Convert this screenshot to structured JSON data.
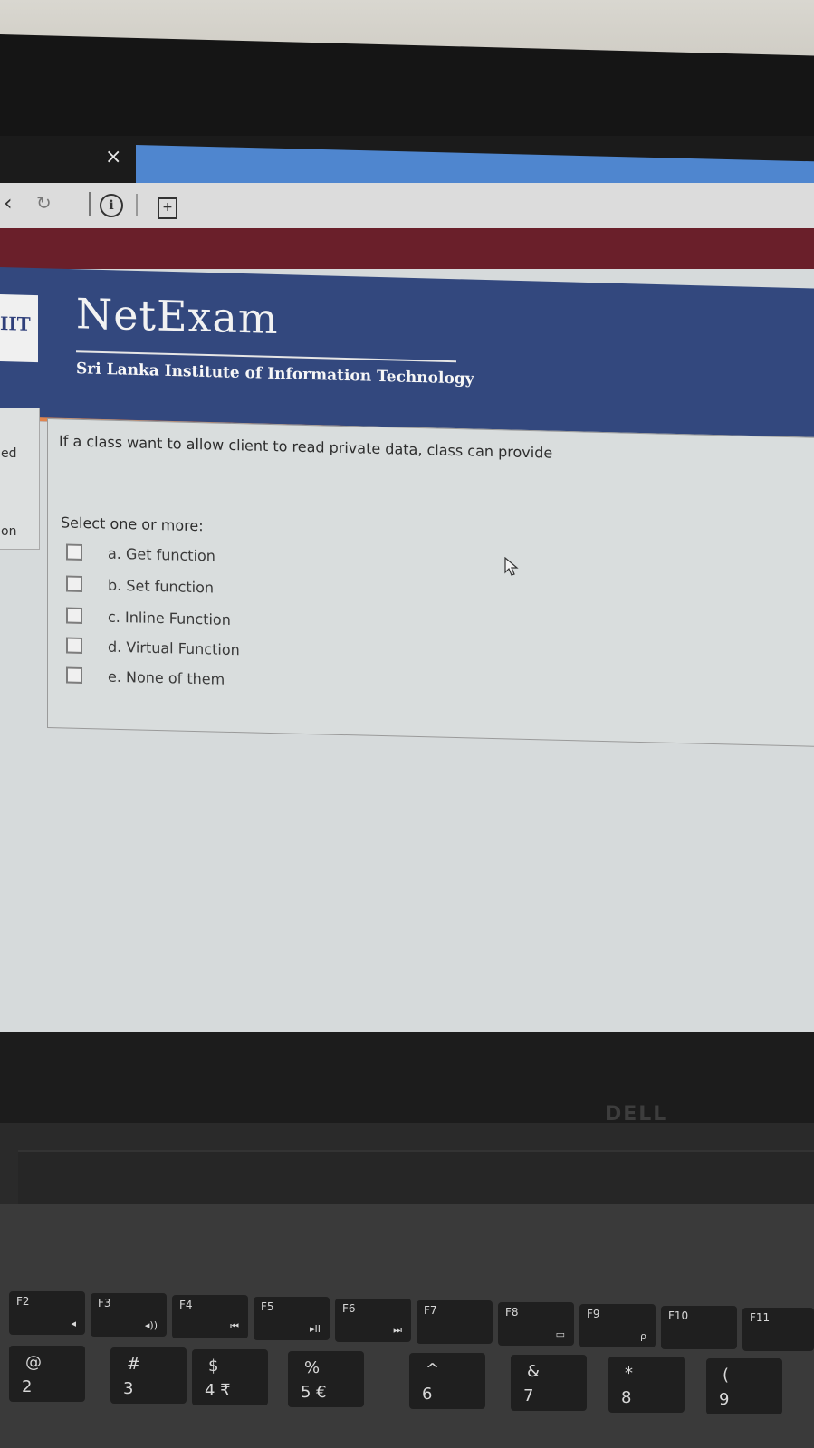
{
  "browser": {
    "tab_close": "×",
    "back_glyph": "‹",
    "reload_glyph": "↻",
    "info_glyph": "i",
    "page_glyph": "+"
  },
  "header": {
    "logo_text": "IIT",
    "title": "NetExam",
    "subtitle": "Sri Lanka Institute of Information Technology"
  },
  "left_nav": {
    "item_1": "ed",
    "item_2": "on"
  },
  "question": {
    "text": "If a class want to allow client to read private data, class can provide",
    "prompt": "Select one or more:",
    "options": [
      {
        "label": "a. Get function",
        "checked": false
      },
      {
        "label": "b. Set function",
        "checked": false
      },
      {
        "label": "c. Inline Function",
        "checked": false
      },
      {
        "label": "d. Virtual Function",
        "checked": false
      },
      {
        "label": "e. None of them",
        "checked": false
      }
    ]
  },
  "laptop": {
    "brand": "DELL"
  },
  "keyboard": {
    "function_keys": [
      {
        "label": "F2",
        "icon": "◂"
      },
      {
        "label": "F3",
        "icon": "◂))"
      },
      {
        "label": "F4",
        "icon": "⏮"
      },
      {
        "label": "F5",
        "icon": "▸II"
      },
      {
        "label": "F6",
        "icon": "⏭"
      },
      {
        "label": "F7",
        "icon": ""
      },
      {
        "label": "F8",
        "icon": "▭"
      },
      {
        "label": "F9",
        "icon": "ρ"
      },
      {
        "label": "F10",
        "icon": ""
      },
      {
        "label": "F11",
        "icon": ""
      }
    ],
    "number_keys": [
      {
        "top": "@",
        "bottom": "2"
      },
      {
        "top": "#",
        "bottom": "3"
      },
      {
        "top": "$",
        "bottom": "4 ₹"
      },
      {
        "top": "%",
        "bottom": "5 €"
      },
      {
        "top": "^",
        "bottom": "6"
      },
      {
        "top": "&",
        "bottom": "7"
      },
      {
        "top": "*",
        "bottom": "8"
      },
      {
        "top": "(",
        "bottom": "9"
      }
    ]
  }
}
